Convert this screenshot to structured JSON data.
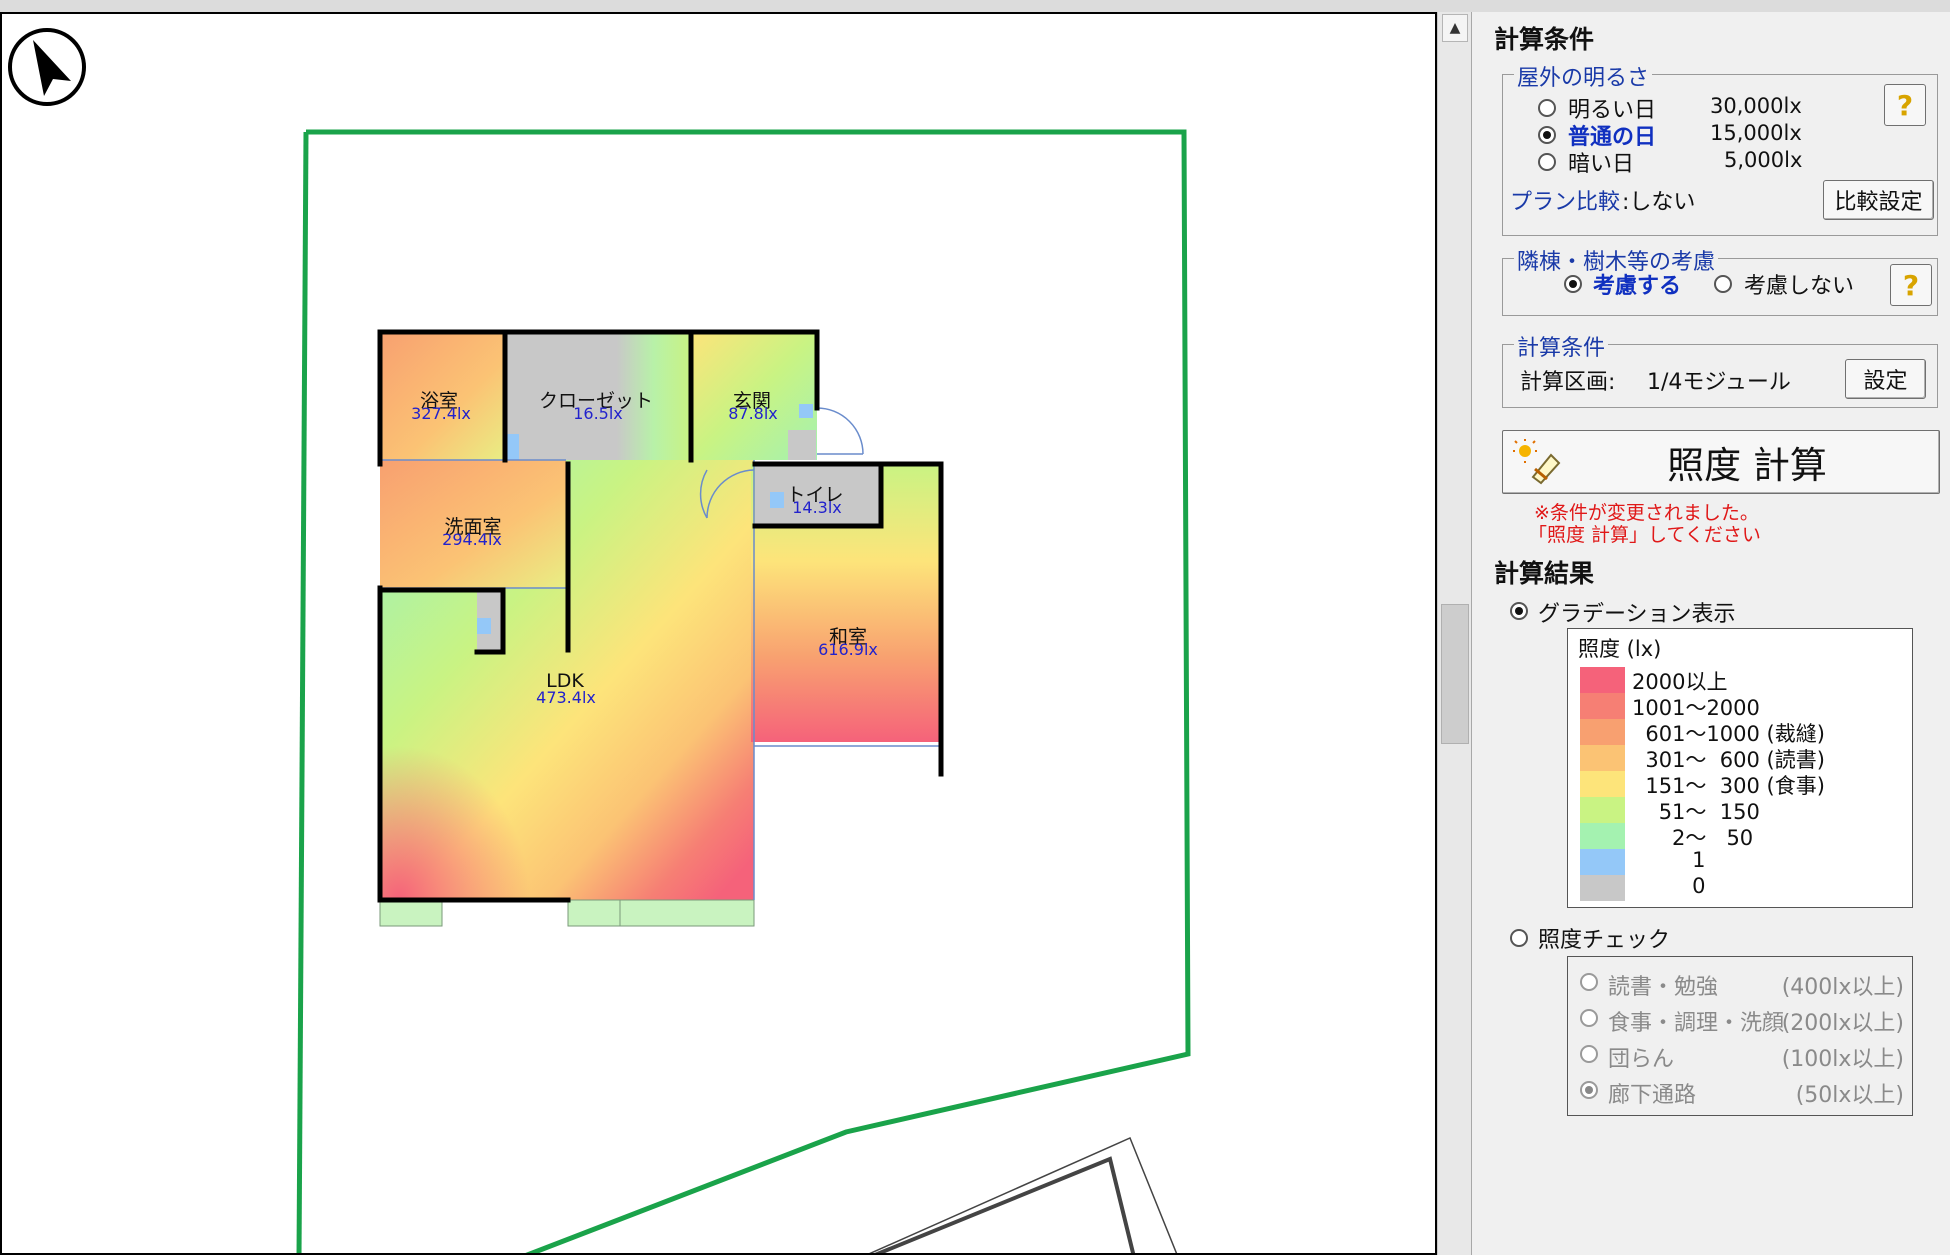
{
  "plan": {
    "rooms": [
      {
        "name": "浴室",
        "lux": "327.4lx"
      },
      {
        "name": "クローゼット",
        "lux": "16.5lx"
      },
      {
        "name": "玄関",
        "lux": "87.8lx"
      },
      {
        "name": "洗面室",
        "lux": "294.4lx"
      },
      {
        "name": "トイレ",
        "lux": "14.3lx"
      },
      {
        "name": "和室",
        "lux": "616.9lx"
      },
      {
        "name": "LDK",
        "lux": "473.4lx"
      }
    ]
  },
  "panel": {
    "header": "計算条件",
    "outdoor": {
      "legend": "屋外の明るさ",
      "options": [
        {
          "label": "明るい日",
          "value": "30,000lx",
          "selected": false
        },
        {
          "label": "普通の日",
          "value": "15,000lx",
          "selected": true
        },
        {
          "label": "暗い日",
          "value": "5,000lx",
          "selected": false
        }
      ],
      "plan_compare_label": "プラン比較",
      "plan_compare_value": ":しない",
      "compare_button": "比較設定",
      "help": "?"
    },
    "neighbors": {
      "legend": "隣棟・樹木等の考慮",
      "consider": "考慮する",
      "not_consider": "考慮しない",
      "help": "?"
    },
    "calc": {
      "legend": "計算条件",
      "section_label": "計算区画:",
      "section_value": "1/4モジュール",
      "settings_button": "設定"
    },
    "calc_button": "照度 計算",
    "notice_1": "※条件が変更されました。",
    "notice_2": "「照度 計算」してください",
    "results_header": "計算結果",
    "gradation_label": "グラデーション表示",
    "legend_title": "照度 (lx)",
    "legend_items": [
      {
        "label": "2000以上",
        "color": "#f5627a"
      },
      {
        "label": "1001〜2000",
        "color": "#f67f74"
      },
      {
        "label": "  601〜1000 (裁縫)",
        "color": "#f8a070"
      },
      {
        "label": "  301〜  600 (読書)",
        "color": "#fbc374"
      },
      {
        "label": "  151〜  300 (食事)",
        "color": "#fde47a"
      },
      {
        "label": "    51〜  150",
        "color": "#c9f383"
      },
      {
        "label": "      2〜   50",
        "color": "#a4f2b0"
      },
      {
        "label": "         1",
        "color": "#94c8f8"
      },
      {
        "label": "         0",
        "color": "#c8c8c8"
      }
    ],
    "check_label": "照度チェック",
    "check_items": [
      {
        "label": "読書・勉強",
        "value": "(400lx以上)",
        "selected": false
      },
      {
        "label": "食事・調理・洗顔",
        "value": "(200lx以上)",
        "selected": false
      },
      {
        "label": "団らん",
        "value": "(100lx以上)",
        "selected": false
      },
      {
        "label": "廊下通路",
        "value": "(50lx以上)",
        "selected": true
      }
    ]
  },
  "colors": {
    "site_boundary": "#1aa34a",
    "wall": "#000000",
    "lux_text": "#2222cc",
    "accent_blue": "#1a3aa8",
    "notice_red": "#e01818"
  }
}
